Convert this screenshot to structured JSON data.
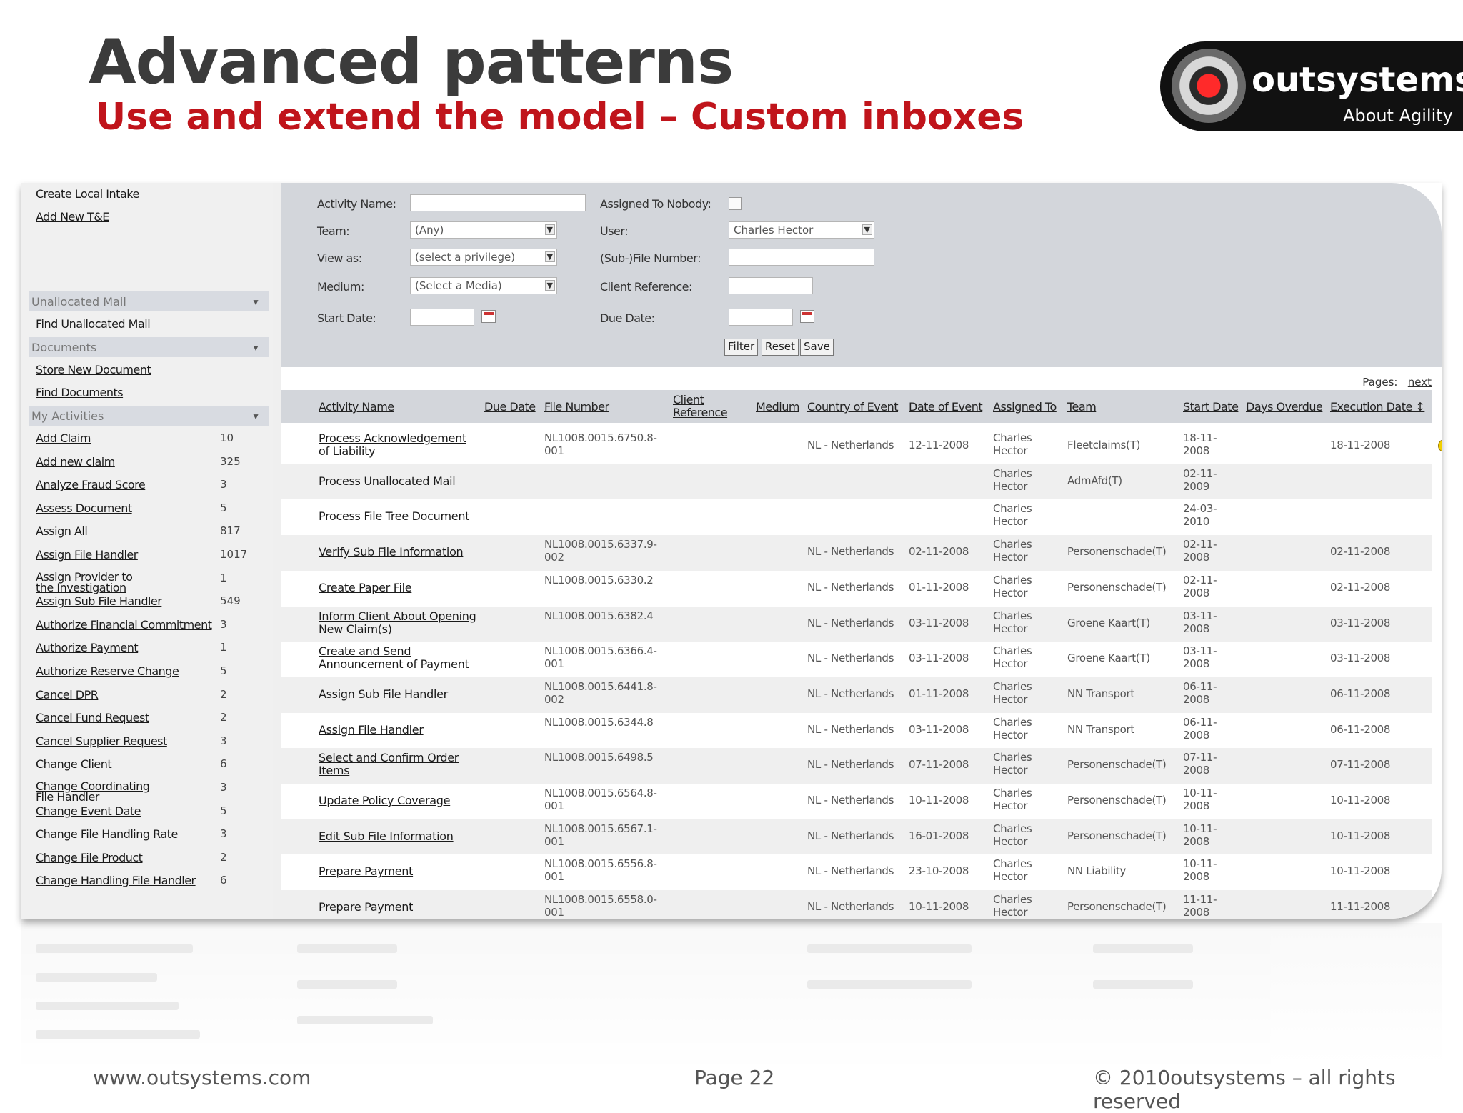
{
  "slide": {
    "title": "Advanced patterns",
    "subtitle": "Use and extend the model – Custom inboxes",
    "logo_word": "outsystems",
    "logo_tag": "About Agility",
    "footer_left": "www.outsystems.com",
    "footer_center": "Page 22",
    "footer_right": "© 2010outsystems – all rights reserved"
  },
  "colors": {
    "title": "#3b3b3b",
    "subtitle": "#c0141b",
    "panel": "#d3d6db",
    "brand": "#ff2a2a"
  },
  "sidebar": {
    "top_links": [
      "Create Local Intake",
      "Add New T&E"
    ],
    "sections": {
      "unallocated": {
        "header": "Unallocated Mail",
        "links": [
          "Find Unallocated Mail"
        ]
      },
      "documents": {
        "header": "Documents",
        "links": [
          "Store New Document",
          "Find Documents"
        ]
      },
      "activities": {
        "header": "My Activities",
        "items": [
          {
            "label": "Add Claim",
            "count": "10"
          },
          {
            "label": "Add new claim",
            "count": "325"
          },
          {
            "label": "Analyze Fraud Score",
            "count": "3"
          },
          {
            "label": "Assess Document",
            "count": "5"
          },
          {
            "label": "Assign All",
            "count": "817"
          },
          {
            "label": "Assign File Handler",
            "count": "1017"
          },
          {
            "label": "Assign Provider to the Investigation",
            "count": "1"
          },
          {
            "label": "Assign Sub File Handler",
            "count": "549"
          },
          {
            "label": "Authorize Financial Commitment",
            "count": "3"
          },
          {
            "label": "Authorize Payment",
            "count": "1"
          },
          {
            "label": "Authorize Reserve Change",
            "count": "5"
          },
          {
            "label": "Cancel DPR",
            "count": "2"
          },
          {
            "label": "Cancel Fund Request",
            "count": "2"
          },
          {
            "label": "Cancel Supplier Request",
            "count": "3"
          },
          {
            "label": "Change Client",
            "count": "6"
          },
          {
            "label": "Change Coordinating File Handler",
            "count": "3"
          },
          {
            "label": "Change Event Date",
            "count": "5"
          },
          {
            "label": "Change File Handling Rate",
            "count": "3"
          },
          {
            "label": "Change File Product",
            "count": "2"
          },
          {
            "label": "Change Handling File Handler",
            "count": "6"
          }
        ]
      }
    }
  },
  "filter": {
    "activity_name_label": "Activity Name:",
    "activity_name_value": "",
    "team_label": "Team:",
    "team_value": "(Any)",
    "view_as_label": "View as:",
    "view_as_value": "(select a privilege)",
    "medium_label": "Medium:",
    "medium_value": "(Select a Media)",
    "start_date_label": "Start Date:",
    "start_date_value": "",
    "assigned_nobody_label": "Assigned To Nobody:",
    "user_label": "User:",
    "user_value": "Charles Hector",
    "subfile_label": "(Sub-)File Number:",
    "subfile_value": "",
    "client_ref_label": "Client Reference:",
    "client_ref_value": "",
    "due_date_label": "Due Date:",
    "due_date_value": "",
    "filter_btn": "Filter",
    "reset_btn": "Reset",
    "save_btn": "Save"
  },
  "pager": {
    "label": "Pages:",
    "next": "next"
  },
  "table": {
    "headers": {
      "activity": "Activity Name",
      "due": "Due Date",
      "file": "File Number",
      "client1": "Client",
      "client2": "Reference",
      "medium": "Medium",
      "country": "Country of Event",
      "date_event": "Date of Event",
      "assigned": "Assigned To",
      "team": "Team",
      "start": "Start Date",
      "overdue": "Days Overdue",
      "exec": "Execution Date ↕"
    },
    "rows": [
      {
        "a1": "Process Acknowledgement",
        "a2": "of Liability",
        "f1": "NL1008.0015.6750.8-",
        "f2": "001",
        "country": "NL - Netherlands",
        "date": "12-11-2008",
        "team": "Fleetclaims(T)",
        "s1": "18-11-",
        "s2": "2008",
        "exec": "18-11-2008",
        "bell": true
      },
      {
        "a1": "Process Unallocated Mail",
        "a2": "",
        "f1": "",
        "f2": "",
        "country": "",
        "date": "",
        "team": "AdmAfd(T)",
        "s1": "02-11-",
        "s2": "2009",
        "exec": ""
      },
      {
        "a1": "Process File Tree Document",
        "a2": "",
        "f1": "",
        "f2": "",
        "country": "",
        "date": "",
        "team": "",
        "s1": "24-03-",
        "s2": "2010",
        "exec": ""
      },
      {
        "a1": "Verify Sub File Information",
        "a2": "",
        "f1": "NL1008.0015.6337.9-",
        "f2": "002",
        "country": "NL - Netherlands",
        "date": "02-11-2008",
        "team": "Personenschade(T)",
        "s1": "02-11-",
        "s2": "2008",
        "exec": "02-11-2008"
      },
      {
        "a1": "Create Paper File",
        "a2": "",
        "f1": "NL1008.0015.6330.2",
        "f2": "",
        "country": "NL - Netherlands",
        "date": "01-11-2008",
        "team": "Personenschade(T)",
        "s1": "02-11-",
        "s2": "2008",
        "exec": "02-11-2008"
      },
      {
        "a1": "Inform Client About Opening",
        "a2": "New Claim(s)",
        "f1": "NL1008.0015.6382.4",
        "f2": "",
        "country": "NL - Netherlands",
        "date": "03-11-2008",
        "team": "Groene Kaart(T)",
        "s1": "03-11-",
        "s2": "2008",
        "exec": "03-11-2008"
      },
      {
        "a1": "Create and Send",
        "a2": "Announcement of Payment",
        "f1": "NL1008.0015.6366.4-",
        "f2": "001",
        "country": "NL - Netherlands",
        "date": "03-11-2008",
        "team": "Groene Kaart(T)",
        "s1": "03-11-",
        "s2": "2008",
        "exec": "03-11-2008"
      },
      {
        "a1": "Assign Sub File Handler",
        "a2": "",
        "f1": "NL1008.0015.6441.8-",
        "f2": "002",
        "country": "NL - Netherlands",
        "date": "01-11-2008",
        "team": "NN Transport",
        "s1": "06-11-",
        "s2": "2008",
        "exec": "06-11-2008"
      },
      {
        "a1": "Assign File Handler",
        "a2": "",
        "f1": "NL1008.0015.6344.8",
        "f2": "",
        "country": "NL - Netherlands",
        "date": "03-11-2008",
        "team": "NN Transport",
        "s1": "06-11-",
        "s2": "2008",
        "exec": "06-11-2008"
      },
      {
        "a1": "Select and Confirm Order",
        "a2": "Items",
        "f1": "NL1008.0015.6498.5",
        "f2": "",
        "country": "NL - Netherlands",
        "date": "07-11-2008",
        "team": "Personenschade(T)",
        "s1": "07-11-",
        "s2": "2008",
        "exec": "07-11-2008"
      },
      {
        "a1": "Update Policy Coverage",
        "a2": "",
        "f1": "NL1008.0015.6564.8-",
        "f2": "001",
        "country": "NL - Netherlands",
        "date": "10-11-2008",
        "team": "Personenschade(T)",
        "s1": "10-11-",
        "s2": "2008",
        "exec": "10-11-2008"
      },
      {
        "a1": "Edit Sub File Information",
        "a2": "",
        "f1": "NL1008.0015.6567.1-",
        "f2": "001",
        "country": "NL - Netherlands",
        "date": "16-01-2008",
        "team": "Personenschade(T)",
        "s1": "10-11-",
        "s2": "2008",
        "exec": "10-11-2008"
      },
      {
        "a1": "Prepare Payment",
        "a2": "",
        "f1": "NL1008.0015.6556.8-",
        "f2": "001",
        "country": "NL - Netherlands",
        "date": "23-10-2008",
        "team": "NN Liability",
        "s1": "10-11-",
        "s2": "2008",
        "exec": "10-11-2008"
      },
      {
        "a1": "Prepare Payment",
        "a2": "",
        "f1": "NL1008.0015.6558.0-",
        "f2": "001",
        "country": "NL - Netherlands",
        "date": "10-11-2008",
        "team": "Personenschade(T)",
        "s1": "11-11-",
        "s2": "2008",
        "exec": "11-11-2008"
      }
    ],
    "assigned_first": "Charles",
    "assigned_last": "Hector"
  }
}
